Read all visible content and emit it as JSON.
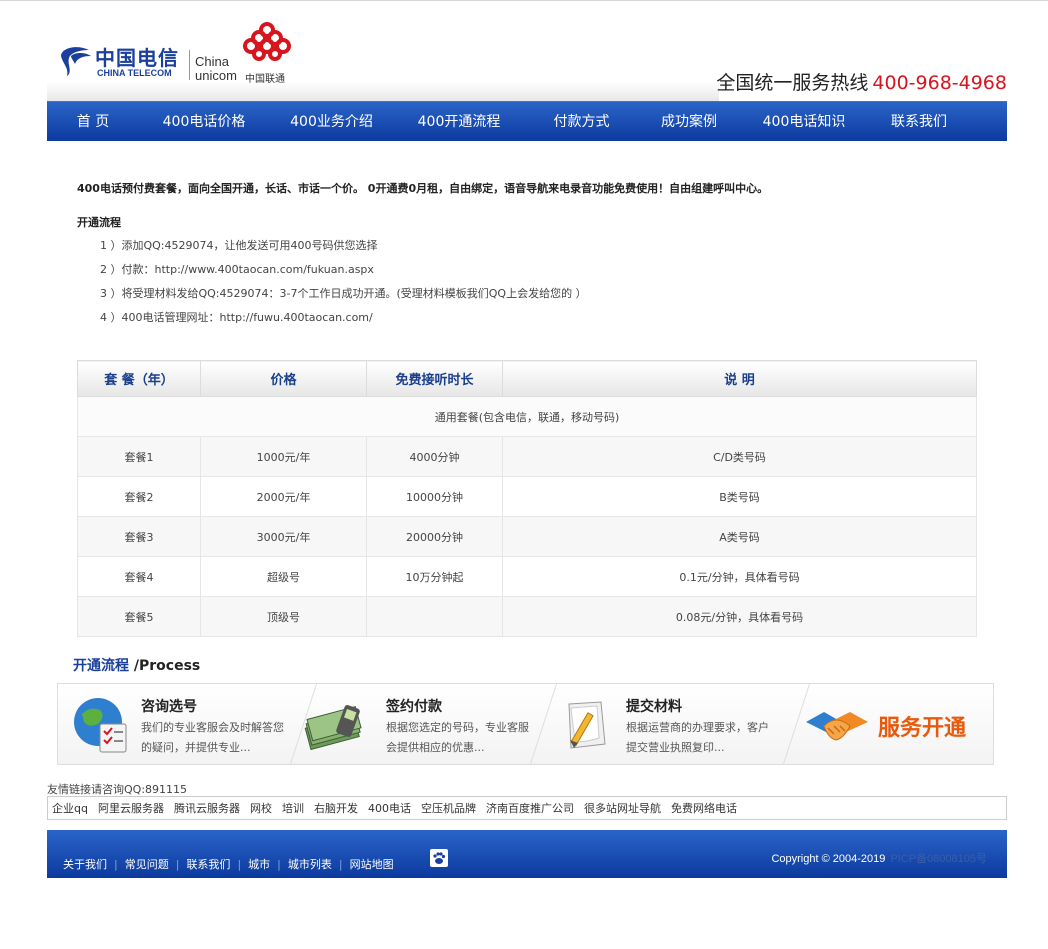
{
  "header": {
    "telecom_cn": "中国电信",
    "telecom_en": "CHINA TELECOM",
    "unicom_china": "China",
    "unicom_en": "unicom",
    "unicom_cn": "中国联通",
    "hotline_label": "全国统一服务热线",
    "hotline_number": "400-968-4968"
  },
  "nav": [
    {
      "label": "首 页"
    },
    {
      "label": "400电话价格"
    },
    {
      "label": "400业务介绍"
    },
    {
      "label": "400开通流程"
    },
    {
      "label": "付款方式"
    },
    {
      "label": "成功案例"
    },
    {
      "label": "400电话知识"
    },
    {
      "label": "联系我们"
    }
  ],
  "intro": "400电话预付费套餐，面向全国开通，长话、市话一个价。 0开通费0月租，自由绑定，语音导航来电录音功能免费使用！自由组建呼叫中心。",
  "flow": {
    "title": "开通流程",
    "steps": [
      "1 ）添加QQ:4529074，让他发送可用400号码供您选择",
      "2 ）付款：http://www.400taocan.com/fukuan.aspx",
      "3 ）将受理材料发给QQ:4529074：3-7个工作日成功开通。(受理材料模板我们QQ上会发给您的 ）",
      "4 ）400电话管理网址：http://fuwu.400taocan.com/"
    ]
  },
  "table": {
    "headers": [
      "套 餐（年）",
      "价格",
      "免费接听时长",
      "说 明"
    ],
    "general": "通用套餐(包含电信，联通，移动号码)",
    "rows": [
      [
        "套餐1",
        "1000元/年",
        "4000分钟",
        "C/D类号码"
      ],
      [
        "套餐2",
        "2000元/年",
        "10000分钟",
        "B类号码"
      ],
      [
        "套餐3",
        "3000元/年",
        "20000分钟",
        "A类号码"
      ],
      [
        "套餐4",
        "超级号",
        "10万分钟起",
        "0.1元/分钟，具体看号码"
      ],
      [
        "套餐5",
        "顶级号",
        "",
        "0.08元/分钟，具体看号码"
      ]
    ]
  },
  "process": {
    "title": "开通流程",
    "title_en": "/Process",
    "steps": [
      {
        "title": "咨询选号",
        "desc": "我们的专业客服会及时解答您的疑问，并提供专业..."
      },
      {
        "title": "签约付款",
        "desc": "根据您选定的号码，专业客服会提供相应的优惠..."
      },
      {
        "title": "提交材料",
        "desc": "根据运营商的办理要求，客户提交营业执照复印..."
      }
    ],
    "final": "服务开通"
  },
  "friend_links": {
    "title": "友情链接请咨询QQ:891115",
    "items": [
      "企业qq",
      "阿里云服务器",
      "腾讯云服务器",
      "网校",
      "培训",
      "右脑开发",
      "400电话",
      "空压机品牌",
      "济南百度推广公司",
      "很多站网址导航",
      "免费网络电话"
    ]
  },
  "footer": {
    "links": [
      "关于我们",
      "常见问题",
      "联系我们",
      "城市",
      "城市列表",
      "网站地图"
    ],
    "copyright": "Copyright © 2004-2019",
    "icp": "PICP备08008105号"
  },
  "colors": {
    "nav_blue": "#1048b0",
    "hotline_red": "#d8141e",
    "title_blue": "#1a3f9c",
    "service_orange": "#e8590c"
  }
}
